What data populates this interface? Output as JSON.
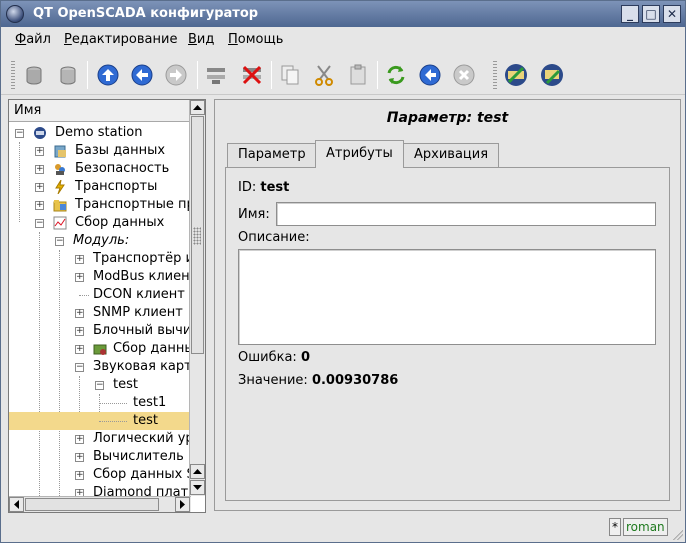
{
  "window": {
    "title": "QT OpenSCADA конфигуратор"
  },
  "menu": {
    "file": {
      "accel": "Ф",
      "rest": "айл"
    },
    "edit": {
      "accel": "Р",
      "rest": "едактирование"
    },
    "view": {
      "accel": "В",
      "rest": "ид"
    },
    "help": {
      "accel": "П",
      "rest": "омощь"
    }
  },
  "tree": {
    "header": "Имя",
    "rows": [
      {
        "label": "Demo station"
      },
      {
        "label": "Базы данных"
      },
      {
        "label": "Безопасность"
      },
      {
        "label": "Транспорты"
      },
      {
        "label": "Транспортные пр"
      },
      {
        "label": "Сбор данных"
      },
      {
        "label": "Модуль:"
      },
      {
        "label": "Транспортёр и"
      },
      {
        "label": "ModBus клиент"
      },
      {
        "label": "DCON клиент"
      },
      {
        "label": "SNMP клиент"
      },
      {
        "label": "Блочный вычис"
      },
      {
        "label": "Сбор данны"
      },
      {
        "label": "Звуковая карта"
      },
      {
        "label": "test"
      },
      {
        "label": "test1"
      },
      {
        "label": "test"
      },
      {
        "label": "Логический уро"
      },
      {
        "label": "Вычислитель н"
      },
      {
        "label": "Сбор данных S"
      },
      {
        "label": "Diamond плать"
      }
    ]
  },
  "panel": {
    "title": "Параметр: test",
    "tabs": [
      "Параметр",
      "Атрибуты",
      "Архивация"
    ],
    "id_label": "ID:",
    "id_value": "test",
    "name_label": "Имя:",
    "name_value": "",
    "desc_label": "Описание:",
    "desc_value": "",
    "error_label": "Ошибка:",
    "error_value": "0",
    "value_label": "Значение:",
    "value_value": "0.00930786"
  },
  "status": {
    "modified": "*",
    "user": "roman"
  },
  "colors": {
    "titlebar": "#4e6791",
    "selection": "#f3d98c",
    "user_text": "#1f7a1f"
  }
}
